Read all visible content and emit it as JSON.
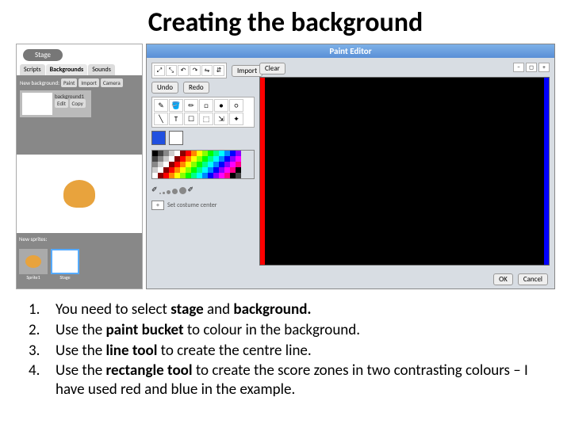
{
  "title": "Creating the background",
  "scratch": {
    "stage_label": "Stage",
    "tabs": [
      "Scripts",
      "Backgrounds",
      "Sounds"
    ],
    "new_bg_label": "New background:",
    "btn_paint": "Paint",
    "btn_import": "Import",
    "btn_camera": "Camera",
    "bg_item_name": "background1",
    "bg_edit": "Edit",
    "bg_copy": "Copy",
    "sprites_label": "New sprites:",
    "sprite1_label": "Sprite1",
    "stage_thumb_label": "Stage"
  },
  "paint": {
    "title": "Paint Editor",
    "import": "Import",
    "clear": "Clear",
    "undo": "Undo",
    "redo": "Redo",
    "tools_row1": [
      "✎",
      "🪣",
      "✏",
      "□",
      "●",
      "○"
    ],
    "tools_row2": [
      "╲",
      "T",
      "☐",
      "⬚",
      "⇲",
      "✦"
    ],
    "set_center": "Set costume center",
    "ok": "OK",
    "cancel": "Cancel",
    "fg_color": "#2050e0",
    "canvas_bg": "#000000",
    "left_stripe": "#ff0000",
    "right_stripe": "#0000ff"
  },
  "steps": [
    {
      "n": "1.",
      "pre": "You need to select ",
      "b1": "stage",
      "mid": " and ",
      "b2": "background.",
      "post": ""
    },
    {
      "n": "2.",
      "pre": "Use the ",
      "b1": "paint bucket",
      "mid": " to colour in the background.",
      "b2": "",
      "post": ""
    },
    {
      "n": "3.",
      "pre": "Use the ",
      "b1": "line tool",
      "mid": " to create the centre line.",
      "b2": "",
      "post": ""
    },
    {
      "n": "4.",
      "pre": "Use the ",
      "b1": "rectangle tool",
      "mid": " to create the score zones in two contrasting colours – I have used red and blue in the example.",
      "b2": "",
      "post": ""
    }
  ]
}
